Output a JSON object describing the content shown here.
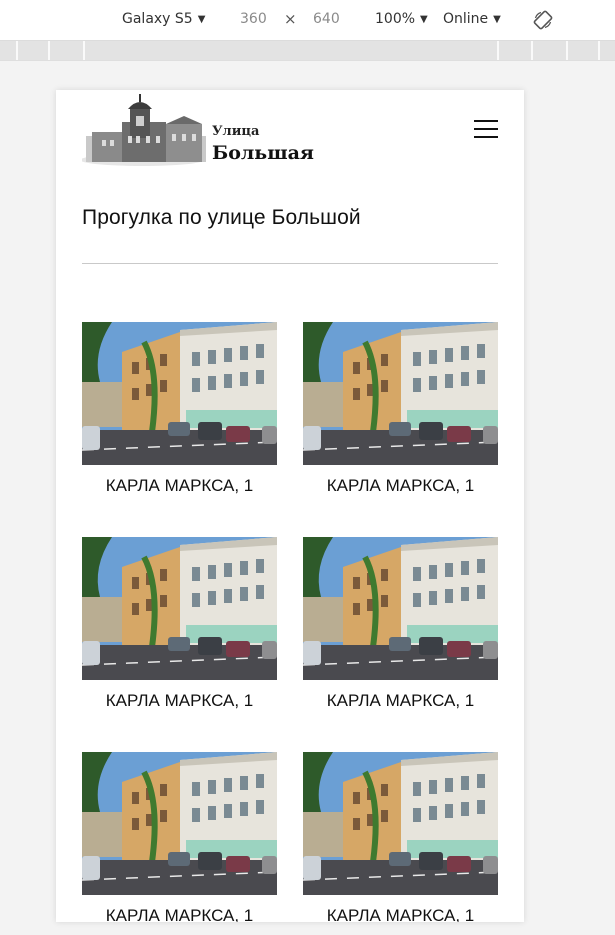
{
  "devtools": {
    "device": "Galaxy S5",
    "width": "360",
    "times": "×",
    "height": "640",
    "zoom": "100%",
    "network": "Online",
    "rotate_icon": "rotate-icon"
  },
  "site": {
    "logo_line1": "Улица",
    "logo_line2": "Большая",
    "menu_icon": "hamburger-menu-icon"
  },
  "page": {
    "title": "Прогулка по улице Большой"
  },
  "cards": [
    {
      "caption": "КАРЛА МАРКСА, 1"
    },
    {
      "caption": "КАРЛА МАРКСА, 1"
    },
    {
      "caption": "КАРЛА МАРКСА, 1"
    },
    {
      "caption": "КАРЛА МАРКСА, 1"
    },
    {
      "caption": "КАРЛА МАРКСА, 1"
    },
    {
      "caption": "КАРЛА МАРКСА, 1"
    }
  ]
}
